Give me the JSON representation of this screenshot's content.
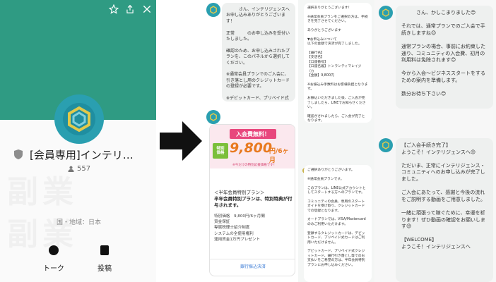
{
  "profile": {
    "account_name": "[会員専用]インテリ…",
    "friend_count": "557",
    "region": "国・地域：日本",
    "tabs": [
      {
        "label": "トーク"
      },
      {
        "label": "投稿"
      }
    ],
    "icons": [
      "star-icon",
      "share-icon",
      "close-icon",
      "shield-icon",
      "person-icon",
      "chat-icon",
      "document-icon"
    ],
    "accent_color": "#2f9b83"
  },
  "chat1": {
    "text": "　　　さん、インテリジェンスへお申し込みありがとうございます！\n\n正常　　　のお申し込みを受付いたしました。\n\n確認のため、お申し込みされたプランを、このパネルから選択してください。\n\n※通常会員プランでのご入会に、引き落とし用のクレジットカードの登録が必要です。\n\n※デビットカード、プリペイド式クレジットカードはご利用いただけません。"
  },
  "promo": {
    "ribbon": "入会費無料！",
    "tag": "特別\n価格",
    "price": "9,800",
    "price_unit": "円/6ヶ月",
    "note": "※今だけの特別応援価格です！",
    "title": "＜半年会員特別プラン＞",
    "desc": "半年会員特別プランは、特別特典が付与されます。",
    "items": [
      "特別価格　9,800円/6ヶ月間",
      "資金保証",
      "専属税理士紹介制度",
      "システムの全使用権利",
      "運用資金1万円プレゼント"
    ],
    "link": "銀行振込決済"
  },
  "chat2": {
    "text1": "選択ありがとうございます！\n\n※通常会員プランをご選択の方は、手続きを完了させてください。\n\nありがとうございます\n\n▼お申込みについて\n以下の金額で決済が完了しました。\n\n【銀行名】\n【支店名】\n【口座番号】\n【口座名義】トンランティマレイジ（カ\n【金額】9,800円\n\n※お振込み手数料はお客様負担となります。\n\nお振込いただきました後、ご入会が完了しましたら、LINEでお知らせください。\n\n確認がされましたら、ご入会が完了となります。",
    "text2": "ご選択ありがとうございます。\n\n※通常会員プランです。\n\nこのプランは、LINE公式アカウントとしてスタートする方へのプランです。\n\nコミュニティの会員、専用のスタートガイドを受け取り、クレジットカードでの登録となります。\n\nカードプランでは、VISA/Mastercardのみご利用いただけます。\n\n登録するクレジットカードは、デビットカード、プリペイド式カードはご利用いただけません。\n\nデビットカード、プリペイド式クレジットカード、銀行引き落とし等でのお支払いをご希望の方は、半年会員特別プランにお申し込みください。"
  },
  "chat3": {
    "text1": "　　　さん、かしこまりました😊\n\nそれでは、通常プランでのご入会で手続きしますね😊\n\n通常プランの場合、事前にお約束した通り、コミュニティの入会費、初月の利用料は免除されます😊\n\n今から入会～ビジネススタートをするための案内を準備します。\n\n数分お待ち下さい😊",
    "text2": "【ご入会手続き完了】\nようこそ！インテリジェンスへ😊\n\nただいま、正常にインテリジェンス・コミュニティへのお申し込みが完了しました。\n\nご入会にあたって、感謝と今後の流れをご説明する動画をご用意しました。\n\n一緒に頑張って稼ぐために、幸運を祈ります！ぜひ動画の確認をお願いします😊\n\n【WELCOME】\nようこそ！インテリジェンスへ"
  }
}
